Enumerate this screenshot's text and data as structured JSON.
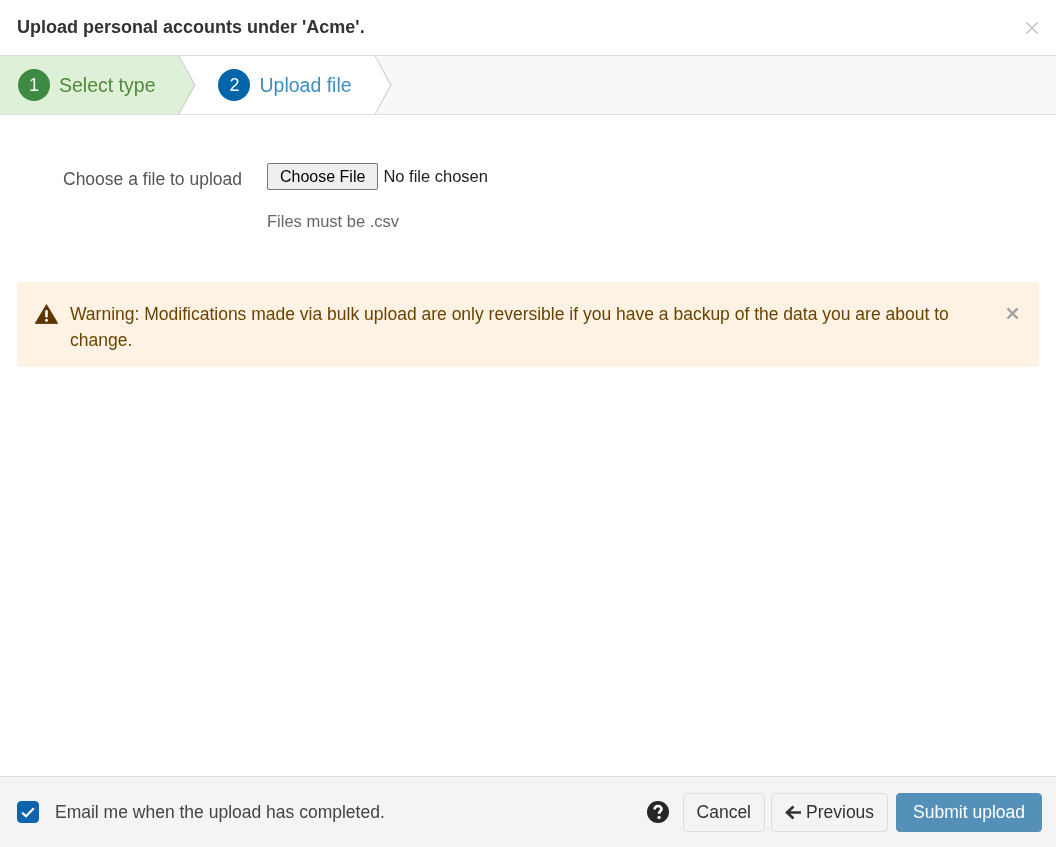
{
  "dialog": {
    "title": "Upload personal accounts under 'Acme'."
  },
  "steps": [
    {
      "number": "1",
      "label": "Select type",
      "completed": true,
      "selected": false
    },
    {
      "number": "2",
      "label": "Upload file",
      "completed": false,
      "selected": true
    }
  ],
  "form": {
    "label": "Choose a file to upload",
    "file_button": "Choose File",
    "file_status": "No file chosen",
    "help": "Files must be .csv"
  },
  "alert": {
    "kind": "warning",
    "text": "Warning: Modifications made via bulk upload are only reversible if you have a backup of the data you are about to change."
  },
  "footer": {
    "email_checkbox": {
      "label": "Email me when the upload has completed.",
      "checked": true
    },
    "buttons": [
      {
        "label": "Cancel",
        "kind": "cancel"
      },
      {
        "label": "Previous",
        "kind": "back"
      },
      {
        "label": "Submit upload",
        "kind": "submit"
      }
    ]
  }
}
